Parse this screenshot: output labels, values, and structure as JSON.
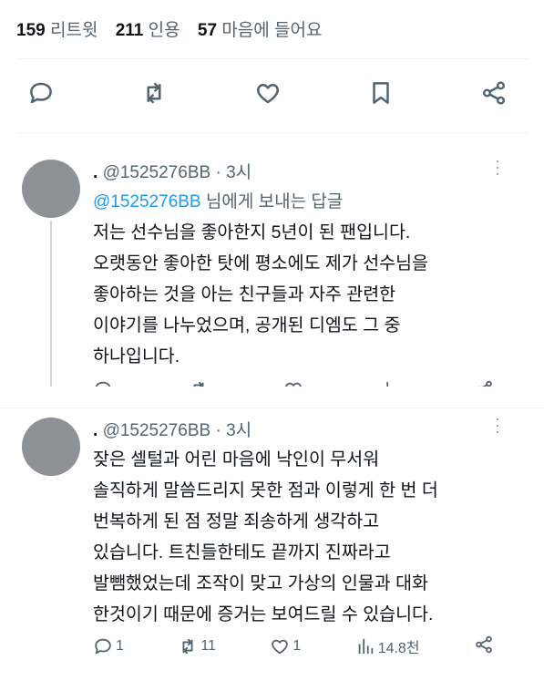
{
  "stats": {
    "retweets_count": "159",
    "retweets_label": "리트윗",
    "quotes_count": "211",
    "quotes_label": "인용",
    "likes_count": "57",
    "likes_label": "마음에 들어요"
  },
  "actions": [
    "reply-icon",
    "retweet-icon",
    "heart-icon",
    "bookmark-icon",
    "share-icon"
  ],
  "replies": [
    {
      "name": ".",
      "handle": "@1525276BB",
      "separator": "·",
      "time": "3시",
      "reply_to_mention": "@1525276BB",
      "reply_to_suffix": "님에게 보내는 답글",
      "text": "저는 선수님을 좋아한지 5년이 된 팬입니다.\n오랫동안 좋아한 탓에 평소에도 제가 선수님을\n좋아하는 것을 아는 친구들과 자주 관련한\n이야기를 나누었으며, 공개된 디엠도 그 중\n하나입니다."
    },
    {
      "name": ".",
      "handle": "@1525276BB",
      "separator": "·",
      "time": "3시",
      "text": "잦은 셀털과 어린 마음에 낙인이 무서워\n솔직하게 말씀드리지 못한 점과 이렇게 한 번 더\n번복하게 된 점 정말 죄송하게 생각하고\n있습니다. 트친들한테도 끝까지 진짜라고\n발뺌했었는데 조작이 맞고 가상의 인물과 대화\n한것이기 때문에 증거는 보여드릴 수 있습니다.",
      "metrics": {
        "replies": "1",
        "retweets": "11",
        "likes": "1",
        "views": "14.8천"
      }
    }
  ]
}
